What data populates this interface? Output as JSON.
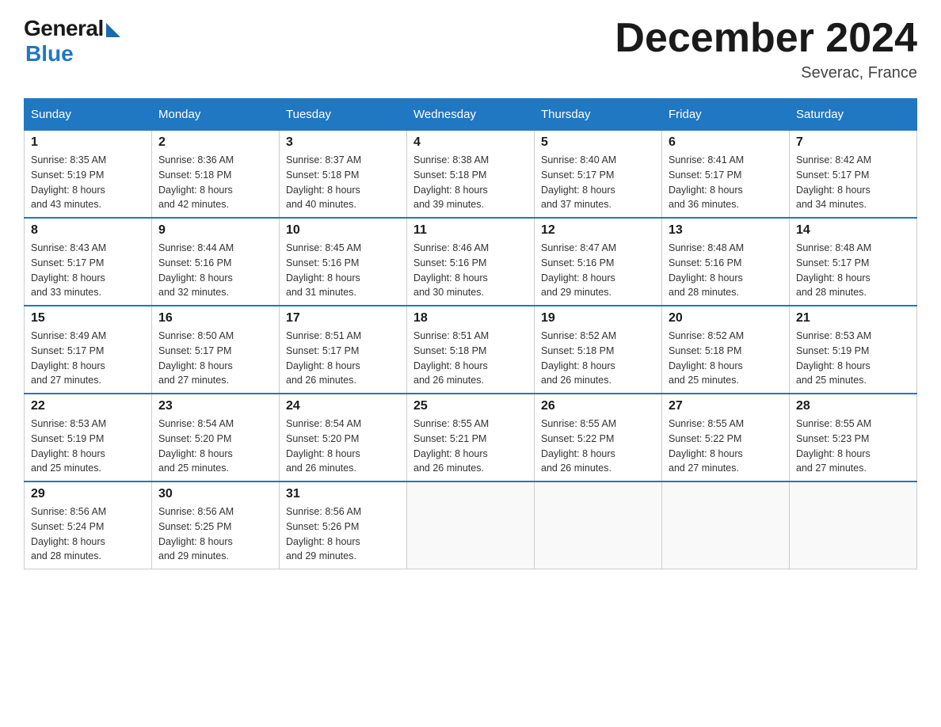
{
  "logo": {
    "general": "General",
    "blue": "Blue"
  },
  "title": "December 2024",
  "location": "Severac, France",
  "days_of_week": [
    "Sunday",
    "Monday",
    "Tuesday",
    "Wednesday",
    "Thursday",
    "Friday",
    "Saturday"
  ],
  "weeks": [
    [
      {
        "day": "1",
        "sunrise": "8:35 AM",
        "sunset": "5:19 PM",
        "daylight": "8 hours and 43 minutes."
      },
      {
        "day": "2",
        "sunrise": "8:36 AM",
        "sunset": "5:18 PM",
        "daylight": "8 hours and 42 minutes."
      },
      {
        "day": "3",
        "sunrise": "8:37 AM",
        "sunset": "5:18 PM",
        "daylight": "8 hours and 40 minutes."
      },
      {
        "day": "4",
        "sunrise": "8:38 AM",
        "sunset": "5:18 PM",
        "daylight": "8 hours and 39 minutes."
      },
      {
        "day": "5",
        "sunrise": "8:40 AM",
        "sunset": "5:17 PM",
        "daylight": "8 hours and 37 minutes."
      },
      {
        "day": "6",
        "sunrise": "8:41 AM",
        "sunset": "5:17 PM",
        "daylight": "8 hours and 36 minutes."
      },
      {
        "day": "7",
        "sunrise": "8:42 AM",
        "sunset": "5:17 PM",
        "daylight": "8 hours and 34 minutes."
      }
    ],
    [
      {
        "day": "8",
        "sunrise": "8:43 AM",
        "sunset": "5:17 PM",
        "daylight": "8 hours and 33 minutes."
      },
      {
        "day": "9",
        "sunrise": "8:44 AM",
        "sunset": "5:16 PM",
        "daylight": "8 hours and 32 minutes."
      },
      {
        "day": "10",
        "sunrise": "8:45 AM",
        "sunset": "5:16 PM",
        "daylight": "8 hours and 31 minutes."
      },
      {
        "day": "11",
        "sunrise": "8:46 AM",
        "sunset": "5:16 PM",
        "daylight": "8 hours and 30 minutes."
      },
      {
        "day": "12",
        "sunrise": "8:47 AM",
        "sunset": "5:16 PM",
        "daylight": "8 hours and 29 minutes."
      },
      {
        "day": "13",
        "sunrise": "8:48 AM",
        "sunset": "5:16 PM",
        "daylight": "8 hours and 28 minutes."
      },
      {
        "day": "14",
        "sunrise": "8:48 AM",
        "sunset": "5:17 PM",
        "daylight": "8 hours and 28 minutes."
      }
    ],
    [
      {
        "day": "15",
        "sunrise": "8:49 AM",
        "sunset": "5:17 PM",
        "daylight": "8 hours and 27 minutes."
      },
      {
        "day": "16",
        "sunrise": "8:50 AM",
        "sunset": "5:17 PM",
        "daylight": "8 hours and 27 minutes."
      },
      {
        "day": "17",
        "sunrise": "8:51 AM",
        "sunset": "5:17 PM",
        "daylight": "8 hours and 26 minutes."
      },
      {
        "day": "18",
        "sunrise": "8:51 AM",
        "sunset": "5:18 PM",
        "daylight": "8 hours and 26 minutes."
      },
      {
        "day": "19",
        "sunrise": "8:52 AM",
        "sunset": "5:18 PM",
        "daylight": "8 hours and 26 minutes."
      },
      {
        "day": "20",
        "sunrise": "8:52 AM",
        "sunset": "5:18 PM",
        "daylight": "8 hours and 25 minutes."
      },
      {
        "day": "21",
        "sunrise": "8:53 AM",
        "sunset": "5:19 PM",
        "daylight": "8 hours and 25 minutes."
      }
    ],
    [
      {
        "day": "22",
        "sunrise": "8:53 AM",
        "sunset": "5:19 PM",
        "daylight": "8 hours and 25 minutes."
      },
      {
        "day": "23",
        "sunrise": "8:54 AM",
        "sunset": "5:20 PM",
        "daylight": "8 hours and 25 minutes."
      },
      {
        "day": "24",
        "sunrise": "8:54 AM",
        "sunset": "5:20 PM",
        "daylight": "8 hours and 26 minutes."
      },
      {
        "day": "25",
        "sunrise": "8:55 AM",
        "sunset": "5:21 PM",
        "daylight": "8 hours and 26 minutes."
      },
      {
        "day": "26",
        "sunrise": "8:55 AM",
        "sunset": "5:22 PM",
        "daylight": "8 hours and 26 minutes."
      },
      {
        "day": "27",
        "sunrise": "8:55 AM",
        "sunset": "5:22 PM",
        "daylight": "8 hours and 27 minutes."
      },
      {
        "day": "28",
        "sunrise": "8:55 AM",
        "sunset": "5:23 PM",
        "daylight": "8 hours and 27 minutes."
      }
    ],
    [
      {
        "day": "29",
        "sunrise": "8:56 AM",
        "sunset": "5:24 PM",
        "daylight": "8 hours and 28 minutes."
      },
      {
        "day": "30",
        "sunrise": "8:56 AM",
        "sunset": "5:25 PM",
        "daylight": "8 hours and 29 minutes."
      },
      {
        "day": "31",
        "sunrise": "8:56 AM",
        "sunset": "5:26 PM",
        "daylight": "8 hours and 29 minutes."
      },
      null,
      null,
      null,
      null
    ]
  ],
  "labels": {
    "sunrise": "Sunrise:",
    "sunset": "Sunset:",
    "daylight": "Daylight:"
  }
}
